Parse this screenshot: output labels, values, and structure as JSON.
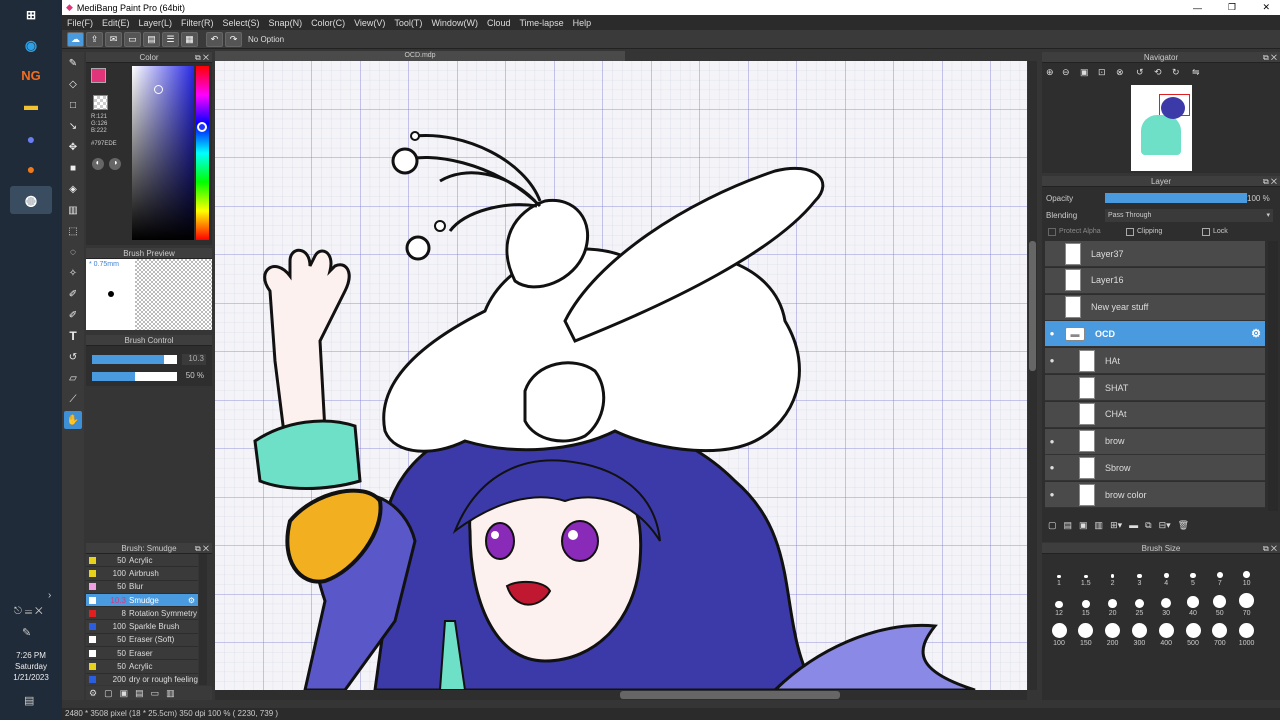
{
  "taskbar": {
    "clock_time": "7:26 PM",
    "clock_day": "Saturday",
    "clock_date": "1/21/2023",
    "ng_label": "NG"
  },
  "window": {
    "title": "MediBang Paint Pro (64bit)"
  },
  "menu": [
    "File(F)",
    "Edit(E)",
    "Layer(L)",
    "Filter(R)",
    "Select(S)",
    "Snap(N)",
    "Color(C)",
    "View(V)",
    "Tool(T)",
    "Window(W)",
    "Cloud",
    "Time-lapse",
    "Help"
  ],
  "toolbar": {
    "snap_option": "No Option"
  },
  "document": {
    "tab": "OCD.mdp"
  },
  "color_panel": {
    "title": "Color",
    "rgb_r": "R:121",
    "rgb_g": "G:126",
    "rgb_b": "B:222",
    "hex": "#797EDE",
    "fg_color": "#e0357a",
    "main_color": "#797EDE"
  },
  "brush_preview": {
    "title": "Brush Preview",
    "size": "* 0.75mm"
  },
  "brush_control": {
    "title": "Brush Control",
    "size_value": "10.3",
    "opacity_value": "50 %",
    "size_fraction": 0.85,
    "opacity_fraction": 0.5
  },
  "brush_panel": {
    "title": "Brush: Smudge",
    "items": [
      {
        "size": "50",
        "name": "Acrylic",
        "color": "#e6d21a"
      },
      {
        "size": "100",
        "name": "Airbrush",
        "color": "#e6d21a"
      },
      {
        "size": "50",
        "name": "Blur",
        "color": "#f0a0e0"
      },
      {
        "size": "10.3",
        "name": "Smudge",
        "color": "#ffffff",
        "selected": true
      },
      {
        "size": "8",
        "name": "Rotation Symmetry",
        "color": "#e02020"
      },
      {
        "size": "100",
        "name": "Sparkle Brush",
        "color": "#2a5de0"
      },
      {
        "size": "50",
        "name": "Eraser (Soft)",
        "color": "#ffffff"
      },
      {
        "size": "50",
        "name": "Eraser",
        "color": "#ffffff"
      },
      {
        "size": "50",
        "name": "Acrylic",
        "color": "#e6d21a"
      },
      {
        "size": "200",
        "name": "dry or rough feeling",
        "color": "#2a5de0"
      }
    ]
  },
  "navigator": {
    "title": "Navigator"
  },
  "layer_panel": {
    "title": "Layer",
    "opacity_label": "Opacity",
    "opacity_value": "100 %",
    "opacity_fraction": 1.0,
    "blending_label": "Blending",
    "blending_value": "Pass Through",
    "protect_alpha": "Protect Alpha",
    "clipping": "Clipping",
    "lock": "Lock",
    "layers": [
      {
        "name": "Layer37",
        "visible": false,
        "indent": false
      },
      {
        "name": "Layer16",
        "visible": false,
        "indent": false
      },
      {
        "name": "New year stuff",
        "visible": false,
        "indent": false
      },
      {
        "name": "OCD",
        "visible": true,
        "indent": false,
        "folder": true,
        "selected": true
      },
      {
        "name": "HAt",
        "visible": true,
        "indent": true
      },
      {
        "name": "SHAT",
        "visible": false,
        "indent": true
      },
      {
        "name": "CHAt",
        "visible": false,
        "indent": true
      },
      {
        "name": "brow",
        "visible": true,
        "indent": true
      },
      {
        "name": "Sbrow",
        "visible": true,
        "indent": true
      },
      {
        "name": "brow color",
        "visible": true,
        "indent": true
      }
    ]
  },
  "brush_size": {
    "title": "Brush Size",
    "sizes": [
      "1",
      "1.5",
      "2",
      "3",
      "4",
      "5",
      "7",
      "10",
      "12",
      "15",
      "20",
      "25",
      "30",
      "40",
      "50",
      "70",
      "100",
      "150",
      "200",
      "300",
      "400",
      "500",
      "700",
      "1000"
    ]
  },
  "status": {
    "text": "2480 * 3508 pixel  (18 * 25.5cm)  350 dpi   100 %   ( 2230, 739 )"
  }
}
